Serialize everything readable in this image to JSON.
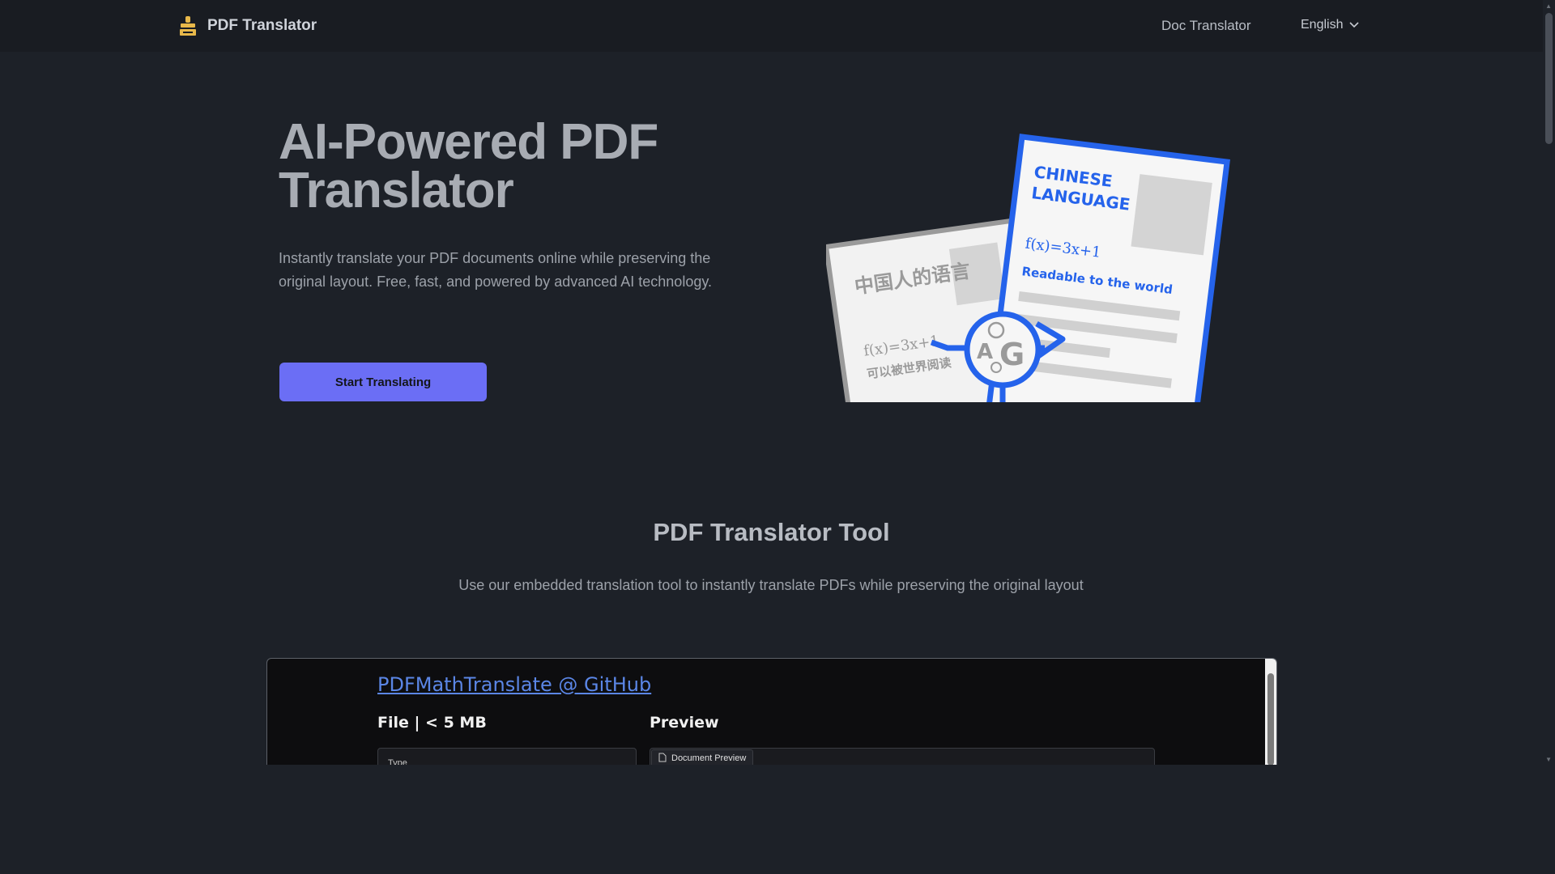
{
  "header": {
    "brand": "PDF Translator",
    "nav_doc": "Doc Translator",
    "language": "English"
  },
  "hero": {
    "title_line1": "AI-Powered PDF",
    "title_line2": "Translator",
    "description": "Instantly translate your PDF documents online while preserving the original layout. Free, fast, and powered by advanced AI technology.",
    "cta_label": "Start Translating"
  },
  "illustration": {
    "back_page_title": "中国人的语言",
    "back_page_formula": "f(x)=3x+1",
    "back_page_sub": "可以被世界阅读",
    "front_page_title_line1": "CHINESE",
    "front_page_title_line2": "LANGUAGE",
    "front_page_formula": "f(x)=3x+1",
    "front_page_sub": "Readable to the world",
    "badge_letter_a": "A",
    "badge_letter_g": "G"
  },
  "tool": {
    "title": "PDF Translator Tool",
    "description": "Use our embedded translation tool to instantly translate PDFs while preserving the original layout"
  },
  "embedded": {
    "link_text": "PDFMathTranslate @ GitHub",
    "file_label": "File | < 5 MB",
    "preview_label": "Preview",
    "type_label": "Type",
    "preview_tab": "Document Preview"
  },
  "colors": {
    "background": "#1d2128",
    "accent": "#6b6ef5",
    "illustration_blue": "#2563eb"
  }
}
